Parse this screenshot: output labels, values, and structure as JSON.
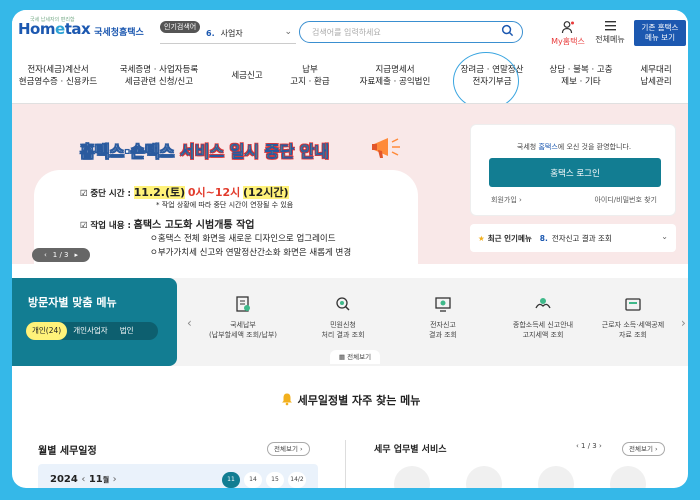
{
  "header": {
    "logo_small": "국세 납세자의 편리함",
    "logo_brand_a": "Hom",
    "logo_brand_e": "e",
    "logo_brand_b": "tax",
    "logo_sub": "국세청홈택스",
    "popular_badge": "인기검색어",
    "popular_num": "6.",
    "popular_term": "사업자",
    "search_placeholder": "검색어를 입력하세요",
    "my_label": "My홈택스",
    "menu_label": "전체메뉴",
    "old_line1": "기존 홈택스",
    "old_line2": "메뉴 보기"
  },
  "nav": [
    {
      "l1": "전자(세금)계산서",
      "l2": "현금영수증 · 신용카드"
    },
    {
      "l1": "국세증명 · 사업자등록",
      "l2": "세금관련 신청/신고"
    },
    {
      "l1": "세금신고",
      "l2": ""
    },
    {
      "l1": "납부",
      "l2": "고지 · 환급"
    },
    {
      "l1": "지급명세서",
      "l2": "자료제출 · 공익법인"
    },
    {
      "l1": "장려금 · 연말정산",
      "l2": "전자기부금"
    },
    {
      "l1": "상담 · 불복 · 고충",
      "l2": "제보 · 기타"
    },
    {
      "l1": "세무대리",
      "l2": "납세관리"
    }
  ],
  "banner": {
    "title_a": "홈택스·손택스",
    "title_b": "서비스 일시 중단 안내",
    "time_label": "중단 시간 :",
    "time_date": "11.2.(토)",
    "time_range": "0시~12시",
    "time_hours": "(12시간)",
    "time_note": "* 작업 상황에 따라 중단 시간이 연장될 수 있음",
    "work_label": "작업 내용 :",
    "work_value": "홈택스 고도화 시범개통 작업",
    "work_line1": "ㅇ홈택스 전체 화면을 새로운 디자인으로 업그레이드",
    "work_line2": "ㅇ부가가치세 신고와 연말정산간소화 화면은 새롭게 변경",
    "pager": "1 / 3"
  },
  "login": {
    "welcome_a": "국세청 ",
    "welcome_b": "홈택스",
    "welcome_c": "에 오신 것을 환영합니다.",
    "button": "홈택스 로그인",
    "join": "회원가입",
    "find": "아이디/비밀번호 찾기"
  },
  "popular": {
    "title": "최근 인기메뉴",
    "num": "8.",
    "term": "전자신고 결과 조회"
  },
  "visitor": {
    "title": "방문자별 맞춤 메뉴",
    "tabs": [
      "개인(24)",
      "개인사업자",
      "법인"
    ],
    "items": [
      {
        "l1": "국세납부",
        "l2": "(납부할세액 조회/납부)"
      },
      {
        "l1": "민원신청",
        "l2": "처리 결과 조회"
      },
      {
        "l1": "전자신고",
        "l2": "결과 조회"
      },
      {
        "l1": "종합소득세 신고안내",
        "l2": "고지세액 조회"
      },
      {
        "l1": "근로자 소득·세액공제",
        "l2": "자료 조회"
      }
    ],
    "more": "전체보기"
  },
  "section_title": "세무일정별 자주 찾는 메뉴",
  "monthly": {
    "title": "월별 세무일정",
    "all": "전체보기",
    "year": "2024",
    "month": "11",
    "month_unit": "월",
    "days": [
      "11",
      "14",
      "15",
      "14/2"
    ]
  },
  "services": {
    "title": "세무 업무별 서비스",
    "pager": "1 / 3",
    "all": "전체보기"
  },
  "colors": {
    "primary": "#127d92",
    "brand": "#1c58b0",
    "bg": "#35b8e8"
  }
}
